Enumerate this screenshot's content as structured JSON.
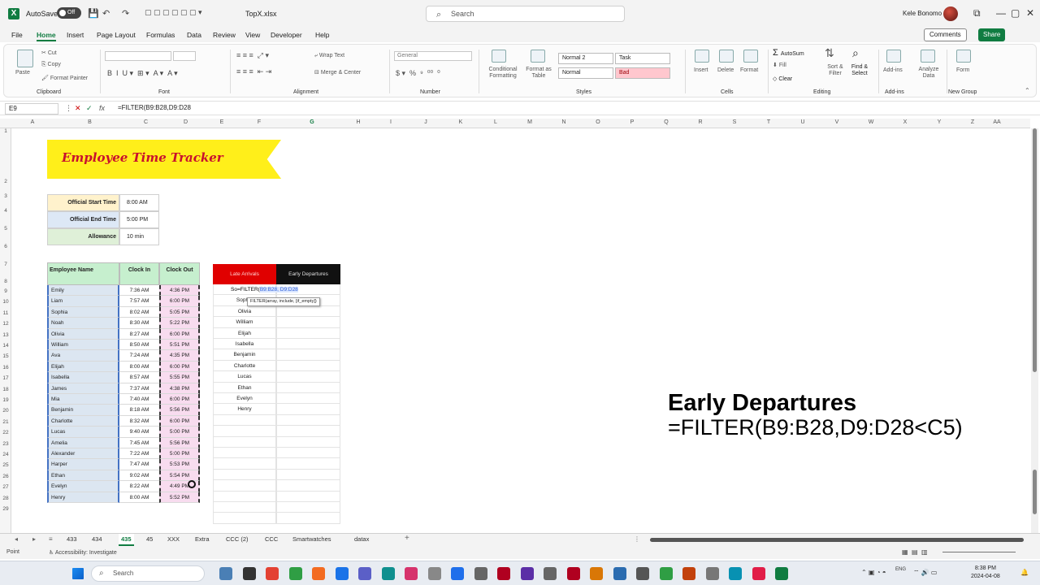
{
  "titlebar": {
    "logo": "X",
    "autosave_label": "AutoSave",
    "autosave_state": "Off",
    "filename": "TopX.xlsx",
    "search_placeholder": "Search",
    "user_name": "Kele Bonomo",
    "icons": [
      "save-icon",
      "undo-icon",
      "redo-icon",
      "minimize-icon",
      "restore-icon",
      "close-icon"
    ]
  },
  "menu": {
    "tabs": [
      "File",
      "Home",
      "Insert",
      "Page Layout",
      "Formulas",
      "Data",
      "Review",
      "View",
      "Developer",
      "Help"
    ],
    "active": "Home",
    "comments_label": "Comments",
    "share_label": "Share"
  },
  "ribbon": {
    "groups": [
      "Clipboard",
      "Font",
      "Alignment",
      "Number",
      "Styles",
      "Cells",
      "Editing",
      "Add-ins",
      "New Group"
    ],
    "clipboard": {
      "paste": "Paste",
      "cut": "Cut",
      "copy": "Copy",
      "format_painter": "Format Painter"
    },
    "alignment": {
      "wrap": "Wrap Text",
      "merge": "Merge & Center"
    },
    "number": {
      "format": "General"
    },
    "styles": {
      "conditional": "Conditional Formatting",
      "format_table": "Format as Table",
      "normal2": "Normal 2",
      "task": "Task",
      "normal": "Normal",
      "bad": "Bad"
    },
    "cells": {
      "insert": "Insert",
      "delete": "Delete",
      "format": "Format"
    },
    "editing": {
      "autosum": "AutoSum",
      "fill": "Fill",
      "clear": "Clear",
      "sort": "Sort & Filter",
      "find": "Find & Select"
    },
    "addins": {
      "addins": "Add-ins",
      "analyze": "Analyze Data",
      "form": "Form"
    }
  },
  "formula_bar": {
    "name_box": "E9",
    "formula": "=FILTER(B9:B28,D9:D28"
  },
  "columns": [
    "A",
    "B",
    "C",
    "D",
    "E",
    "F",
    "G",
    "H",
    "I",
    "J",
    "K",
    "L",
    "M",
    "N",
    "O",
    "P",
    "Q",
    "R",
    "S",
    "T",
    "U",
    "V",
    "W",
    "X",
    "Y",
    "Z",
    "AA"
  ],
  "rows": [
    "1",
    "2",
    "3",
    "4",
    "5",
    "6",
    "7",
    "8",
    "9",
    "10",
    "11",
    "12",
    "13",
    "14",
    "15",
    "16",
    "17",
    "18",
    "19",
    "20",
    "21",
    "22",
    "23",
    "24",
    "25",
    "26",
    "27",
    "28",
    "29"
  ],
  "banner_title": "Employee Time Tracker",
  "settings": [
    {
      "label": "Official Start Time",
      "value": "8:00 AM"
    },
    {
      "label": "Official End Time",
      "value": "5:00 PM"
    },
    {
      "label": "Allowance",
      "value": "10 min"
    }
  ],
  "employee_table": {
    "headers": [
      "Employee Name",
      "Clock In",
      "Clock Out"
    ],
    "rows": [
      [
        "Emily",
        "7:36 AM",
        "4:36 PM"
      ],
      [
        "Liam",
        "7:57 AM",
        "6:00 PM"
      ],
      [
        "Sophia",
        "8:02 AM",
        "5:05 PM"
      ],
      [
        "Noah",
        "8:30 AM",
        "5:22 PM"
      ],
      [
        "Olivia",
        "8:27 AM",
        "6:00 PM"
      ],
      [
        "William",
        "8:50 AM",
        "5:51 PM"
      ],
      [
        "Ava",
        "7:24 AM",
        "4:35 PM"
      ],
      [
        "Elijah",
        "8:00 AM",
        "6:00 PM"
      ],
      [
        "Isabella",
        "8:57 AM",
        "5:55 PM"
      ],
      [
        "James",
        "7:37 AM",
        "4:38 PM"
      ],
      [
        "Mia",
        "7:40 AM",
        "6:00 PM"
      ],
      [
        "Benjamin",
        "8:18 AM",
        "5:56 PM"
      ],
      [
        "Charlotte",
        "8:32 AM",
        "6:00 PM"
      ],
      [
        "Lucas",
        "9:40 AM",
        "5:00 PM"
      ],
      [
        "Amelia",
        "7:45 AM",
        "5:56 PM"
      ],
      [
        "Alexander",
        "7:22 AM",
        "5:00 PM"
      ],
      [
        "Harper",
        "7:47 AM",
        "5:53 PM"
      ],
      [
        "Ethan",
        "9:02 AM",
        "5:54 PM"
      ],
      [
        "Evelyn",
        "8:22 AM",
        "4:49 PM"
      ],
      [
        "Henry",
        "8:00 AM",
        "5:52 PM"
      ]
    ]
  },
  "result_table": {
    "headers": [
      "Late Arrivals",
      "Early Departures"
    ],
    "editing_text": "So=FILTER(",
    "editing_ref": "B9:B28, D9:D28",
    "tooltip": "FILTER(array, include, [if_empty])",
    "late": [
      "",
      "Sophia",
      "Olivia",
      "William",
      "Elijah",
      "Isabella",
      "Benjamin",
      "Charlotte",
      "Lucas",
      "Ethan",
      "Evelyn",
      "Henry"
    ]
  },
  "annotation": {
    "title": "Early Departures",
    "formula": "=FILTER(B9:B28,D9:D28<C5)"
  },
  "sheet_tabs": [
    "433",
    "434",
    "435",
    "45",
    "XXX",
    "Extra",
    "CCC (2)",
    "CCC",
    "Smartwatches",
    "datax"
  ],
  "active_sheet": "435",
  "status": {
    "ready": "Point",
    "accessibility": "Accessibility: Investigate"
  },
  "taskbar": {
    "search_placeholder": "Search",
    "time": "8:38 PM",
    "date": "2024-04-08",
    "lang": "ENG"
  }
}
